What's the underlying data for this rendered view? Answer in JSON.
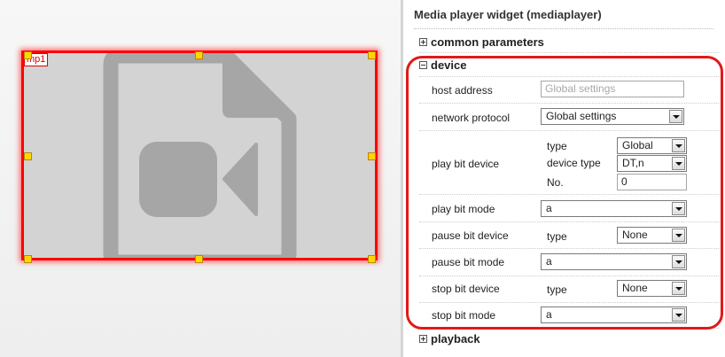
{
  "canvas": {
    "widget": {
      "label": "mp1"
    }
  },
  "panel": {
    "title": "Media player widget (mediaplayer)",
    "sections": {
      "common": "common parameters",
      "device": "device",
      "playback": "playback"
    },
    "device": {
      "host_address": {
        "label": "host address",
        "placeholder": "Global settings"
      },
      "network_protocol": {
        "label": "network protocol",
        "value": "Global settings"
      },
      "play_bit_device": {
        "label": "play bit device",
        "type_label": "type",
        "type_value": "Global",
        "device_type_label": "device type",
        "device_type_value": "DT,n",
        "no_label": "No.",
        "no_value": "0"
      },
      "play_bit_mode": {
        "label": "play bit mode",
        "value": "a"
      },
      "pause_bit_device": {
        "label": "pause bit device",
        "type_label": "type",
        "type_value": "None"
      },
      "pause_bit_mode": {
        "label": "pause bit mode",
        "value": "a"
      },
      "stop_bit_device": {
        "label": "stop bit device",
        "type_label": "type",
        "type_value": "None"
      },
      "stop_bit_mode": {
        "label": "stop bit mode",
        "value": "a"
      }
    }
  },
  "colors": {
    "selection": "#ff0000",
    "handle": "#ffd700",
    "icon": "#a6a6a6",
    "widget_bg": "#d3d3d3",
    "highlight": "#e11919"
  },
  "icons": {
    "placeholder": "video-file-icon",
    "expand": "plus-box-icon",
    "collapse": "minus-box-icon",
    "dropdown": "chevron-down-icon"
  }
}
